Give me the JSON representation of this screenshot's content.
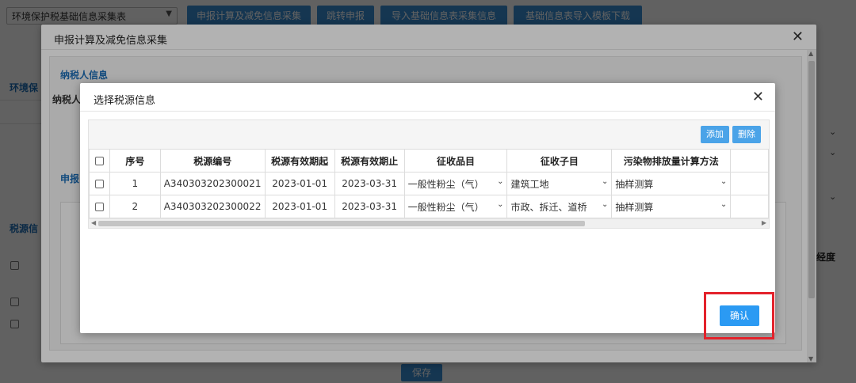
{
  "background": {
    "select_value": "环境保护税基础信息采集表",
    "buttons": [
      "申报计算及减免信息采集",
      "跳转申报",
      "导入基础信息表采集信息",
      "基础信息表导入模板下载"
    ],
    "side_label_1": "环境保",
    "side_label_2": "税源信",
    "right_label": "经度",
    "save_label": "保存"
  },
  "outer_dialog": {
    "title": "申报计算及减免信息采集",
    "close_icon": "close-icon",
    "taxpayer_section": "纳税人信息",
    "taxpayer_name_label": "纳税人",
    "declaration_section": "申报"
  },
  "inner_dialog": {
    "title": "选择税源信息",
    "close_icon": "close-icon",
    "add_label": "添加",
    "delete_label": "删除",
    "columns": [
      "序号",
      "税源编号",
      "税源有效期起",
      "税源有效期止",
      "征收品目",
      "征收子目",
      "污染物排放量计算方法"
    ],
    "rows": [
      {
        "seq": "1",
        "id": "A340303202300021",
        "start": "2023-01-01",
        "end": "2023-03-31",
        "item": "一般性粉尘（气）",
        "subitem": "建筑工地",
        "method": "抽样测算"
      },
      {
        "seq": "2",
        "id": "A340303202300022",
        "start": "2023-01-01",
        "end": "2023-03-31",
        "item": "一般性粉尘（气）",
        "subitem": "市政、拆迁、道桥",
        "method": "抽样测算"
      }
    ],
    "confirm_label": "确认"
  },
  "colors": {
    "primary_button": "#2b9af3",
    "highlight_box": "#e3222b",
    "section_label": "#1d6db5"
  }
}
